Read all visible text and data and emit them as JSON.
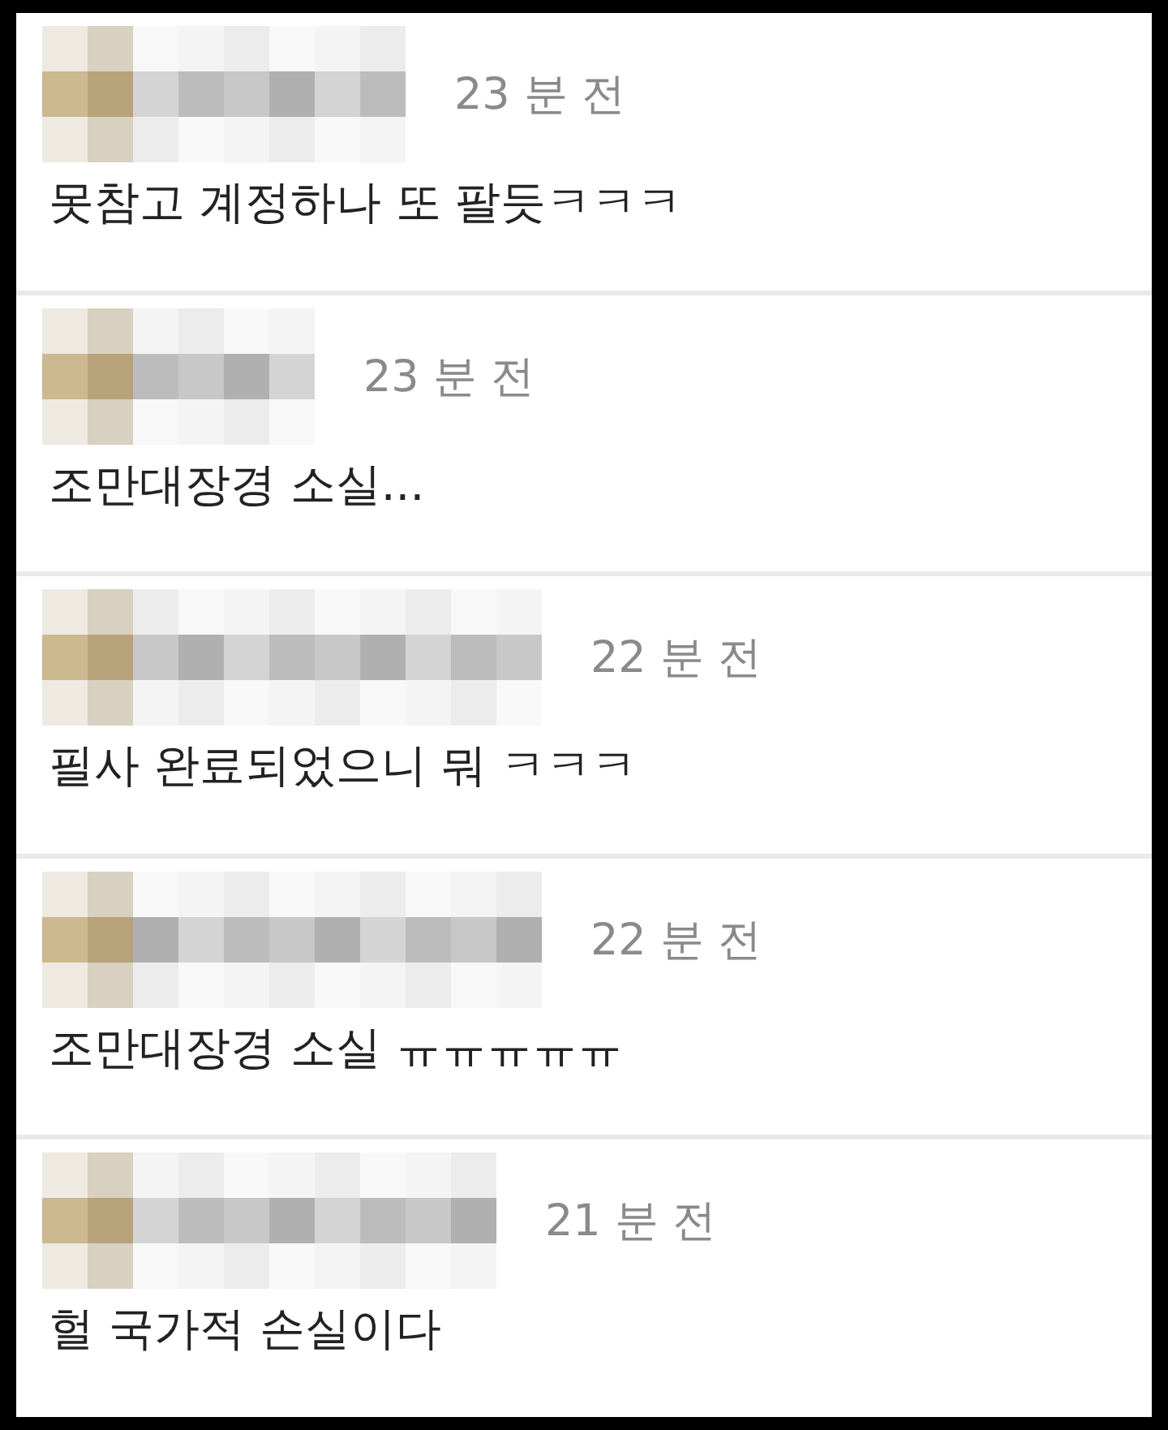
{
  "comments": [
    {
      "time": "23 분 전",
      "text": "못참고 계정하나 또 팔듯ㅋㅋㅋ"
    },
    {
      "time": "23 분 전",
      "text": "조만대장경 소실..."
    },
    {
      "time": "22 분 전",
      "text": "필사 완료되었으니 뭐 ㅋㅋㅋ"
    },
    {
      "time": "22 분 전",
      "text": "조만대장경 소실 ㅠㅠㅠㅠㅠ"
    },
    {
      "time": "21 분 전",
      "text": "헐 국가적 손실이다"
    }
  ]
}
